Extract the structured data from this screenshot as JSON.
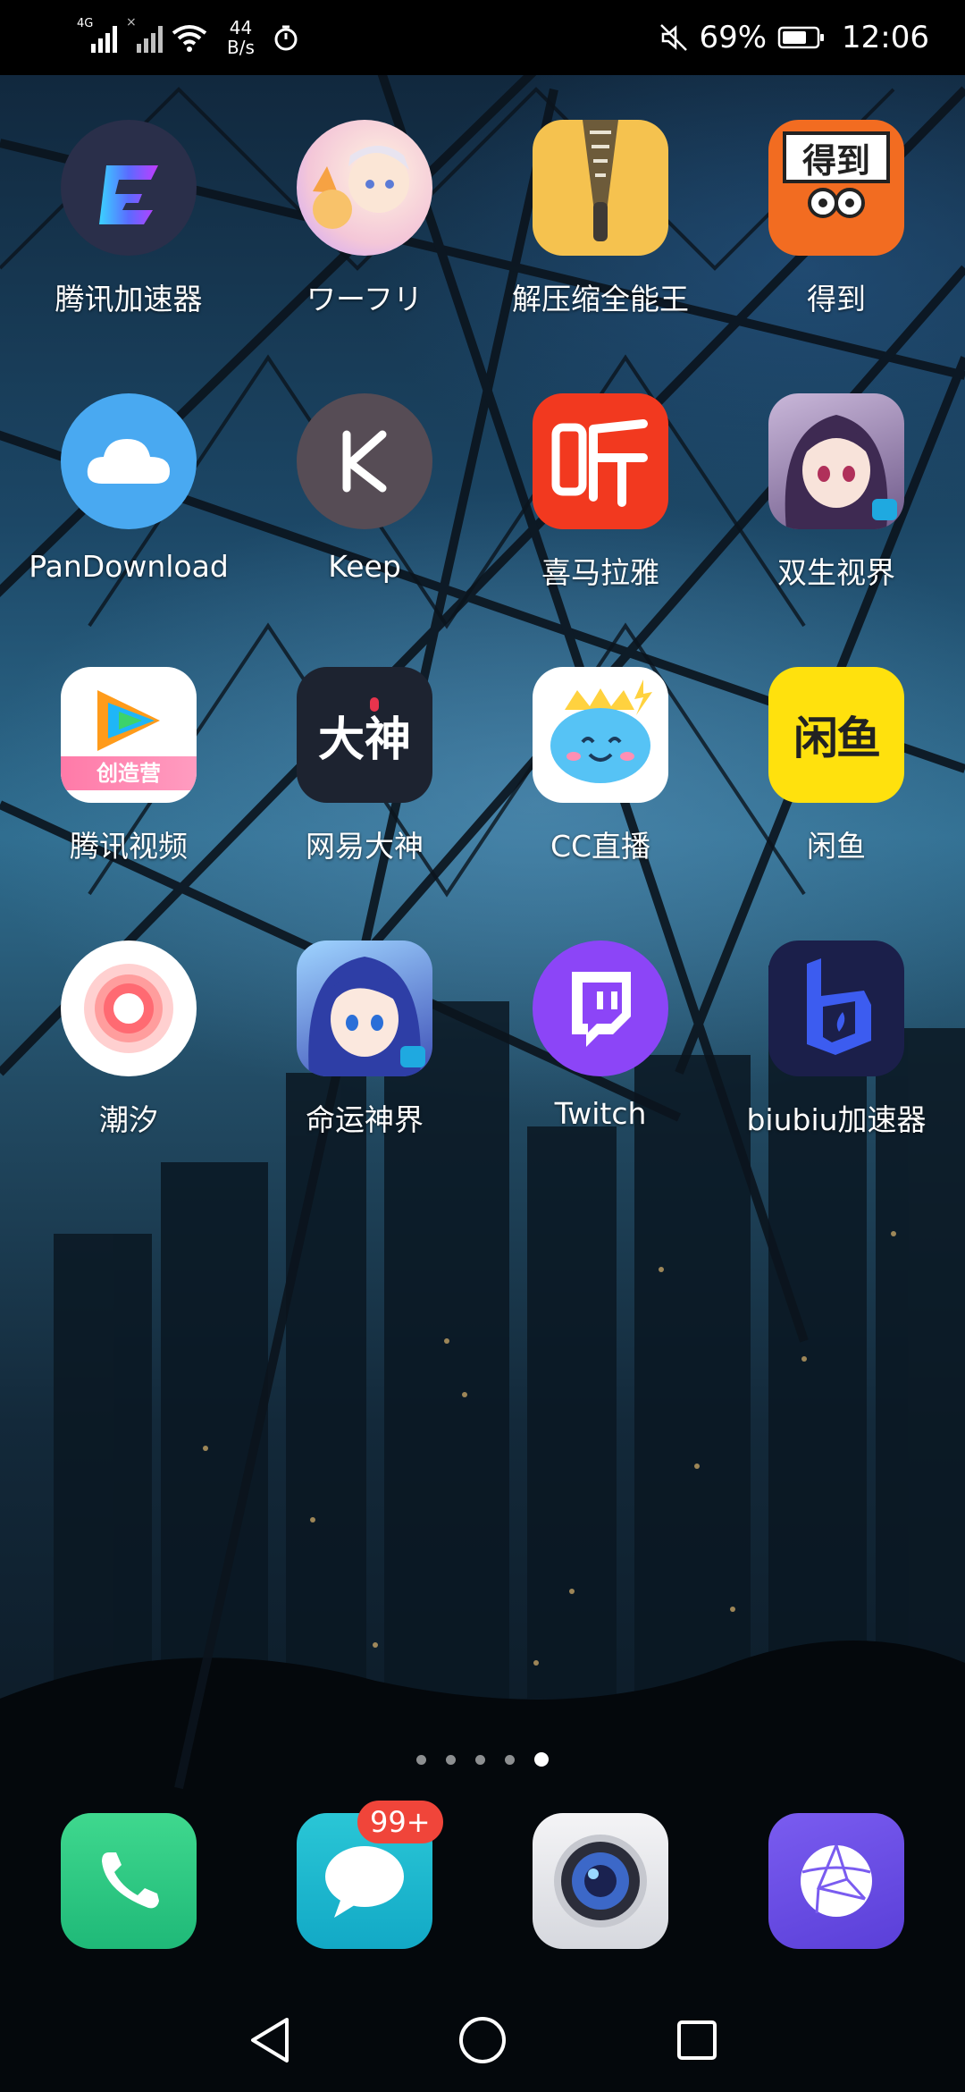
{
  "status_bar": {
    "network_type": "4G",
    "net_speed_value": "44",
    "net_speed_unit": "B/s",
    "battery_percent": "69%",
    "time": "12:06",
    "icons": [
      "signal-icon",
      "signal-no-sim-icon",
      "wifi-icon",
      "stopwatch-icon",
      "mute-icon",
      "battery-icon"
    ]
  },
  "apps": [
    {
      "label": "腾讯加速器",
      "icon": "tencent-accelerator-icon"
    },
    {
      "label": "ワーフリ",
      "icon": "worldflipper-icon"
    },
    {
      "label": "解压缩全能王",
      "icon": "zip-icon"
    },
    {
      "label": "得到",
      "icon": "dedao-icon",
      "text": "得到"
    },
    {
      "label": "PanDownload",
      "icon": "cloud-icon"
    },
    {
      "label": "Keep",
      "icon": "keep-icon",
      "text": "K"
    },
    {
      "label": "喜马拉雅",
      "icon": "ximalaya-icon",
      "text": "听"
    },
    {
      "label": "双生视界",
      "icon": "game-girl-icon"
    },
    {
      "label": "腾讯视频",
      "icon": "tencent-video-icon",
      "text": "创造营"
    },
    {
      "label": "网易大神",
      "icon": "netease-dashen-icon",
      "text": "大神"
    },
    {
      "label": "CC直播",
      "icon": "cc-live-icon"
    },
    {
      "label": "闲鱼",
      "icon": "xianyu-icon",
      "text": "闲鱼"
    },
    {
      "label": "潮汐",
      "icon": "tide-icon"
    },
    {
      "label": "命运神界",
      "icon": "game-boy-icon"
    },
    {
      "label": "Twitch",
      "icon": "twitch-icon"
    },
    {
      "label": "biubiu加速器",
      "icon": "biubiu-icon"
    }
  ],
  "page_indicator": {
    "pages": 5,
    "current": 5
  },
  "dock": [
    {
      "name": "phone",
      "icon": "phone-icon"
    },
    {
      "name": "messages",
      "icon": "message-icon",
      "badge": "99+"
    },
    {
      "name": "camera",
      "icon": "camera-icon"
    },
    {
      "name": "browser",
      "icon": "browser-icon"
    }
  ],
  "nav": [
    "back-icon",
    "home-icon",
    "recents-icon"
  ],
  "colors": {
    "badge": "#f0453a",
    "statusbar": "#000000"
  }
}
